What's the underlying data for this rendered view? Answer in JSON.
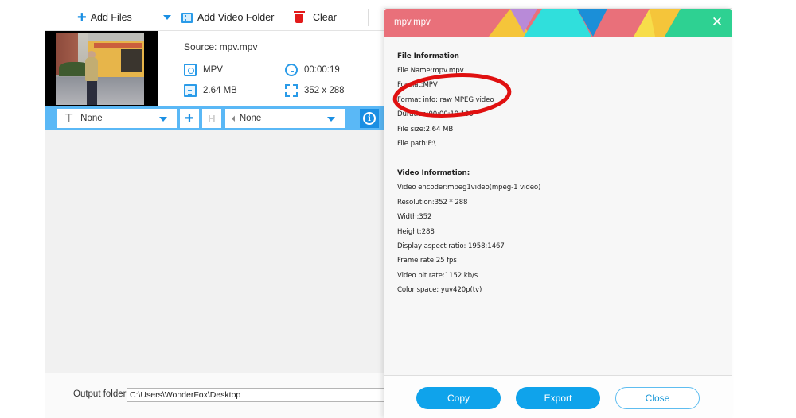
{
  "toolbar": {
    "add_files": "Add Files",
    "add_video_folder": "Add Video Folder",
    "clear": "Clear"
  },
  "file": {
    "source": "Source: mpv.mpv",
    "format": "MPV",
    "duration": "00:00:19",
    "size": "2.64 MB",
    "resolution": "352 x 288"
  },
  "options": {
    "subtitle": "None",
    "audio": "None"
  },
  "output": {
    "label": "Output folder:",
    "path": "C:\\Users\\WonderFox\\Desktop"
  },
  "dialog": {
    "title": "mpv.mpv",
    "close_glyph": "✕",
    "file_info_heading": "File Information",
    "file_info": [
      "File Name:mpv.mpv",
      "Format:MPV",
      "Format info: raw MPEG video",
      "Duration:00:00:19.199",
      "File size:2.64 MB",
      "File path:F:\\"
    ],
    "video_info_heading": "Video Information:",
    "video_info": [
      "Video encoder:mpeg1video(mpeg-1 video)",
      "Resolution:352 * 288",
      "Width:352",
      "Height:288",
      "Display aspect ratio: 1958:1467",
      "Frame rate:25 fps",
      "Video bit rate:1152 kb/s",
      "Color space: yuv420p(tv)"
    ],
    "buttons": {
      "copy": "Copy",
      "export": "Export",
      "close": "Close"
    }
  },
  "colors": {
    "accent": "#1a8fe3",
    "option_bar": "#5ab8f6",
    "button_fill": "#0fa3eb",
    "annotation": "#e01010",
    "header_red": "#e9707a",
    "header_yellow": "#f5c53a",
    "header_purple": "#b88ad8",
    "header_cyan": "#30dfdc",
    "header_blue": "#1b8fd8",
    "header_green": "#2ed192"
  }
}
